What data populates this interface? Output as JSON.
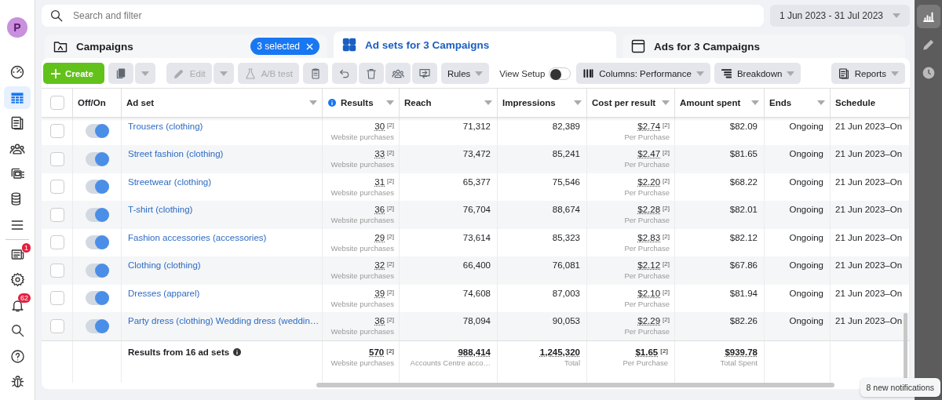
{
  "left_nav": {
    "avatar": "P",
    "items": [
      {
        "kind": "gauge",
        "selected": false
      },
      {
        "kind": "table",
        "selected": true
      },
      {
        "kind": "pages",
        "selected": false
      },
      {
        "kind": "people",
        "selected": false
      },
      {
        "kind": "stack",
        "selected": false
      },
      {
        "kind": "coins",
        "selected": false
      },
      {
        "kind": "menu",
        "selected": false
      }
    ],
    "bottom_items": [
      {
        "kind": "news",
        "badge": "1"
      },
      {
        "kind": "gear"
      },
      {
        "kind": "bell",
        "badge": "62"
      },
      {
        "kind": "search"
      },
      {
        "kind": "help"
      },
      {
        "kind": "bug"
      }
    ]
  },
  "search": {
    "placeholder": "Search and filter"
  },
  "date_range": "1 Jun 2023 - 31 Jul 2023",
  "tabs": [
    {
      "kind": "folder",
      "label": "Campaigns",
      "selected": false,
      "chip": "3 selected"
    },
    {
      "kind": "grid",
      "label": "Ad sets for 3 Campaigns",
      "selected": true
    },
    {
      "kind": "window",
      "label": "Ads for 3 Campaigns",
      "selected": false
    }
  ],
  "toolbar": {
    "create": {
      "label": "Create",
      "disabled": false
    },
    "edit": {
      "label": "Edit",
      "disabled": true
    },
    "ab_test": {
      "label": "A/B test",
      "disabled": true
    },
    "rules": "Rules",
    "view_setup": {
      "label": "View Setup",
      "on": false
    },
    "columns": "Columns: Performance",
    "breakdown": "Breakdown",
    "reports": "Reports"
  },
  "table": {
    "columns": [
      {
        "kind": "check",
        "checked": false
      },
      {
        "label": "Off/On",
        "kind": "toggle",
        "menu": false,
        "info": false
      },
      {
        "label": "Ad set",
        "kind": "name",
        "menu": true,
        "info": false
      },
      {
        "label": "Results",
        "kind": "metric",
        "menu": true,
        "info": true
      },
      {
        "label": "Reach",
        "kind": "num",
        "menu": true,
        "info": false
      },
      {
        "label": "Impressions",
        "kind": "num",
        "menu": true,
        "info": false
      },
      {
        "label": "Cost per result",
        "kind": "metric",
        "menu": true,
        "info": false
      },
      {
        "label": "Amount spent",
        "kind": "num",
        "menu": true,
        "info": false
      },
      {
        "label": "Ends",
        "kind": "num",
        "menu": true,
        "info": false
      },
      {
        "label": "Schedule",
        "kind": "text",
        "menu": false,
        "info": false
      }
    ],
    "rows": [
      {
        "checked": false,
        "on": true,
        "name": "Trousers (clothing)",
        "results": {
          "value": "30",
          "note": "[2]",
          "label": "Website purchases"
        },
        "reach": "71,312",
        "impressions": "82,389",
        "cost": {
          "value": "$2.74",
          "note": "[2]",
          "label": "Per Purchase"
        },
        "spent": "$82.09",
        "ends": "Ongoing",
        "schedule": "21 Jun 2023–On"
      },
      {
        "checked": false,
        "on": true,
        "name": "Street fashion (clothing)",
        "results": {
          "value": "33",
          "note": "[2]",
          "label": "Website purchases"
        },
        "reach": "73,472",
        "impressions": "85,241",
        "cost": {
          "value": "$2.47",
          "note": "[2]",
          "label": "Per Purchase"
        },
        "spent": "$81.65",
        "ends": "Ongoing",
        "schedule": "21 Jun 2023–On"
      },
      {
        "checked": false,
        "on": true,
        "name": "Streetwear (clothing)",
        "results": {
          "value": "31",
          "note": "[2]",
          "label": "Website purchases"
        },
        "reach": "65,377",
        "impressions": "75,546",
        "cost": {
          "value": "$2.20",
          "note": "[2]",
          "label": "Per Purchase"
        },
        "spent": "$68.22",
        "ends": "Ongoing",
        "schedule": "21 Jun 2023–On"
      },
      {
        "checked": false,
        "on": true,
        "name": "T-shirt (clothing)",
        "results": {
          "value": "36",
          "note": "[2]",
          "label": "Website purchases"
        },
        "reach": "76,704",
        "impressions": "88,674",
        "cost": {
          "value": "$2.28",
          "note": "[2]",
          "label": "Per Purchase"
        },
        "spent": "$82.01",
        "ends": "Ongoing",
        "schedule": "21 Jun 2023–On"
      },
      {
        "checked": false,
        "on": true,
        "name": "Fashion accessories (accessories)",
        "results": {
          "value": "29",
          "note": "[2]",
          "label": "Website purchases"
        },
        "reach": "73,614",
        "impressions": "85,323",
        "cost": {
          "value": "$2.83",
          "note": "[2]",
          "label": "Per Purchase"
        },
        "spent": "$82.12",
        "ends": "Ongoing",
        "schedule": "21 Jun 2023–On"
      },
      {
        "checked": false,
        "on": true,
        "name": "Clothing (clothing)",
        "results": {
          "value": "32",
          "note": "[2]",
          "label": "Website purchases"
        },
        "reach": "66,400",
        "impressions": "76,081",
        "cost": {
          "value": "$2.12",
          "note": "[2]",
          "label": "Per Purchase"
        },
        "spent": "$67.86",
        "ends": "Ongoing",
        "schedule": "21 Jun 2023–On"
      },
      {
        "checked": false,
        "on": true,
        "name": "Dresses (apparel)",
        "results": {
          "value": "39",
          "note": "[2]",
          "label": "Website purchases"
        },
        "reach": "74,608",
        "impressions": "87,003",
        "cost": {
          "value": "$2.10",
          "note": "[2]",
          "label": "Per Purchase"
        },
        "spent": "$81.94",
        "ends": "Ongoing",
        "schedule": "21 Jun 2023–On"
      },
      {
        "checked": false,
        "on": true,
        "name": "Party dress (clothing) Wedding dress (weddin…",
        "results": {
          "value": "36",
          "note": "[2]",
          "label": "Website purchases"
        },
        "reach": "78,094",
        "impressions": "90,053",
        "cost": {
          "value": "$2.29",
          "note": "[2]",
          "label": "Per Purchase"
        },
        "spent": "$82.26",
        "ends": "Ongoing",
        "schedule": "21 Jun 2023–On"
      }
    ],
    "footer": {
      "label": "Results from 16 ad sets",
      "results": {
        "value": "570",
        "note": "[2]",
        "label": "Website purchases"
      },
      "reach": {
        "value": "988,414",
        "label": "Accounts Centre acco…"
      },
      "impressions": {
        "value": "1,245,320",
        "label": "Total"
      },
      "cost": {
        "value": "$1.65",
        "note": "[2]",
        "label": "Per Purchase"
      },
      "spent": {
        "value": "$939.78",
        "label": "Total Spent"
      }
    }
  },
  "right_bar": {
    "items": [
      {
        "kind": "chart",
        "selected": true
      },
      {
        "kind": "pencil",
        "selected": false
      },
      {
        "kind": "clock",
        "selected": false
      }
    ]
  },
  "toast": "8 new notifications"
}
